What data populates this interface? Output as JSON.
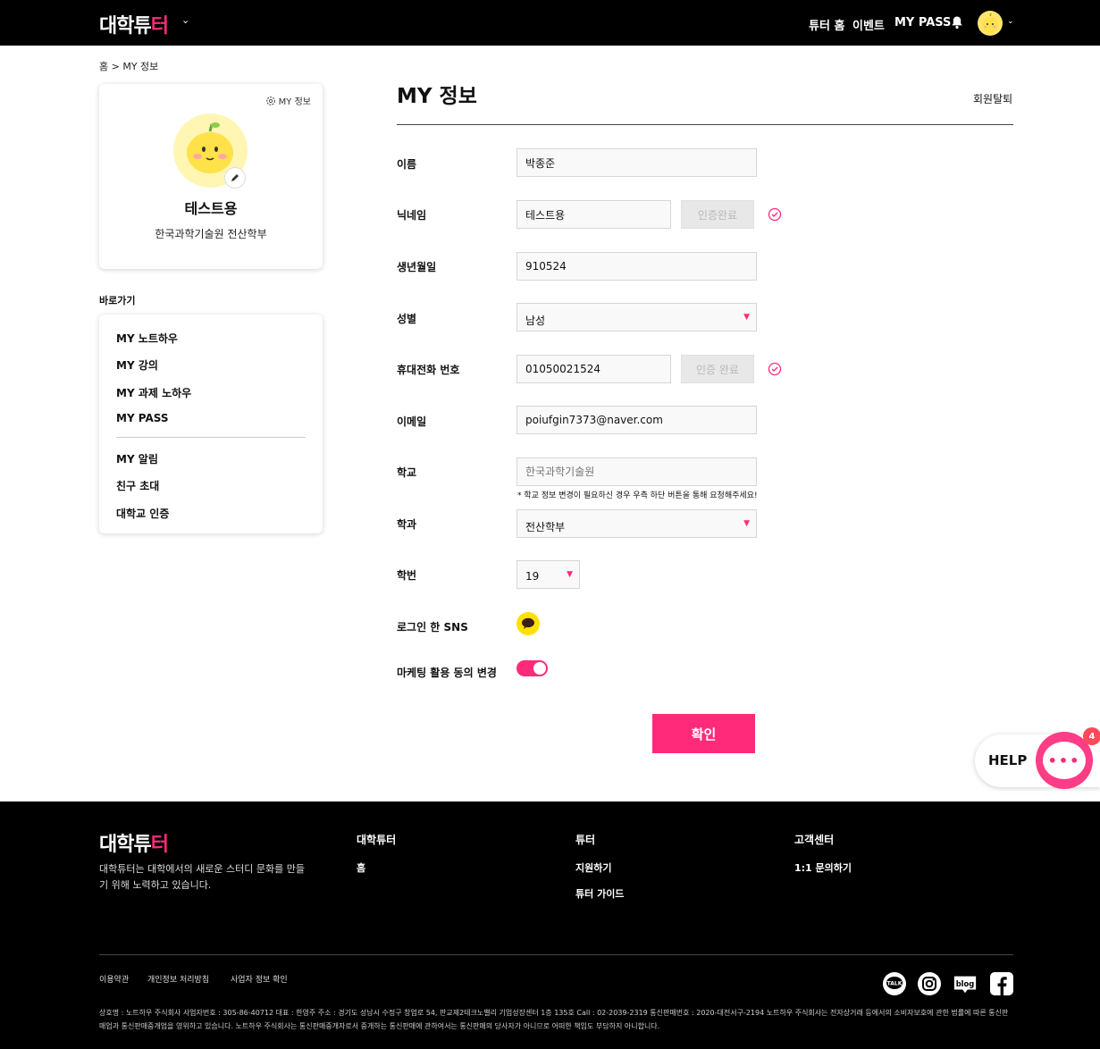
{
  "header": {
    "logo_main": "대학튜",
    "logo_accent": "터",
    "nav": [
      "튜터 홈",
      "이벤트",
      "MY PASS"
    ]
  },
  "breadcrumb": "홈 > MY 정보",
  "profile": {
    "settings_label": "MY 정보",
    "name": "테스트용",
    "school": "한국과학기술원 전산학부"
  },
  "shortcuts": {
    "title": "바로가기",
    "items": [
      "MY 노트하우",
      "MY 강의",
      "MY 과제 노하우",
      "MY PASS",
      "MY 알림",
      "친구 초대",
      "대학교 인증"
    ]
  },
  "main": {
    "title": "MY 정보",
    "withdraw": "회원탈퇴",
    "fields": {
      "name": {
        "label": "이름",
        "value": "박종준"
      },
      "nickname": {
        "label": "닉네임",
        "value": "테스트용",
        "verify": "인증완료"
      },
      "birth": {
        "label": "생년월일",
        "value": "910524"
      },
      "gender": {
        "label": "성별",
        "value": "남성"
      },
      "phone": {
        "label": "휴대전화 번호",
        "value": "01050021524",
        "verify": "인증 완료"
      },
      "email": {
        "label": "이메일",
        "value": "poiufgin7373@naver.com"
      },
      "school": {
        "label": "학교",
        "placeholder": "한국과학기술원",
        "note": "* 학교 정보 변경이 필요하신 경우 우측 하단 버튼을 통해 요청해주세요!"
      },
      "dept": {
        "label": "학과",
        "value": "전산학부"
      },
      "year": {
        "label": "학번",
        "value": "19"
      },
      "sns": {
        "label": "로그인 한 SNS",
        "icon": "kakao-talk-icon"
      },
      "marketing": {
        "label": "마케팅 활용 동의 변경",
        "enabled": true
      }
    },
    "confirm": "확인"
  },
  "help": {
    "label": "HELP",
    "badge": "4"
  },
  "footer": {
    "logo_main": "대학튜",
    "logo_accent": "터",
    "desc": "대학튜터는 대학에서의 새로운 스터디 문화를 만들기 위해 노력하고 있습니다.",
    "cols": [
      {
        "title": "대학튜터",
        "links": [
          "홈"
        ]
      },
      {
        "title": "튜터",
        "links": [
          "지원하기",
          "튜터 가이드"
        ]
      },
      {
        "title": "고객센터",
        "links": [
          "1:1 문의하기"
        ]
      }
    ],
    "bottom_links": [
      "이용약관",
      "개인정보 처리방침",
      "사업자 정보 확인"
    ],
    "company": "상호명 : 노트하우 주식회사 사업자번호 : 305-86-40712 대표 : 한영주 주소 : 경기도 성남시 수정구 창업로 54, 판교제2테크노밸리 기업성장센터 1층 135호 Call : 02-2039-2319 통신판매번호 : 2020-대전서구-2194 노트하우 주식회사는 전자상거래 등에서의 소비자보호에 관한 법률에 따른 통신판매업과 통신판매중개업을 영위하고 있습니다. 노트하우 주식회사는 통신판매중개자로서 중개하는 통신판매에 관하여서는 통신판매의 당사자가 아니므로 어떠한 책임도 부담하지 아니합니다.",
    "sns": [
      "talk-icon",
      "instagram-icon",
      "blog-icon",
      "facebook-icon"
    ],
    "sns_blog_label": "blog",
    "sns_talk_label": "TALK"
  },
  "colors": {
    "accent": "#ff2b7a",
    "header_bg": "#000000",
    "footer_bg": "#000000"
  }
}
